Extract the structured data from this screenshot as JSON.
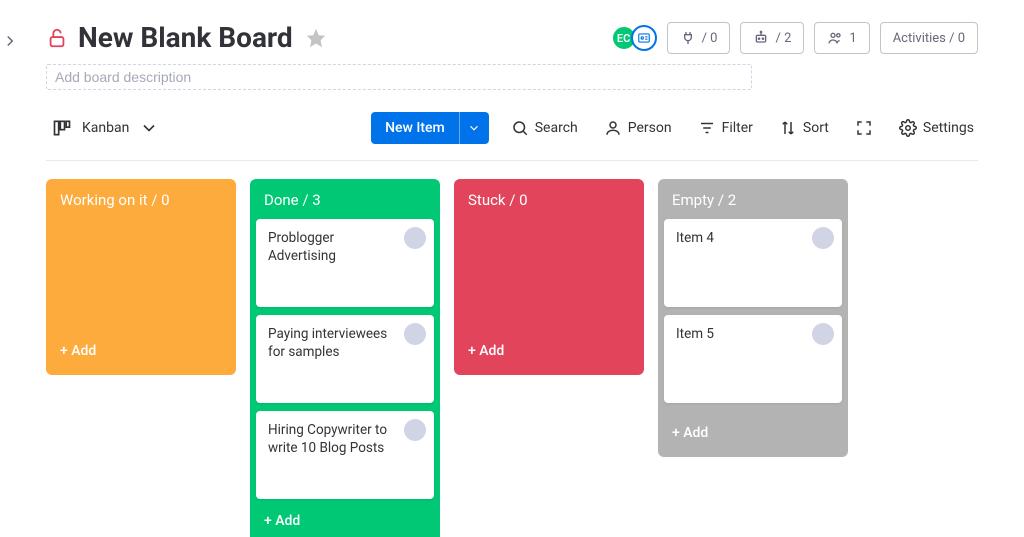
{
  "board": {
    "title": "New Blank Board",
    "description_placeholder": "Add board description"
  },
  "members": {
    "avatar1_label": "EC",
    "plug_count": "/ 0",
    "robot_count": "/ 2",
    "people_count": "1",
    "activities_label": "Activities / 0"
  },
  "toolbar": {
    "view_label": "Kanban",
    "new_item_label": "New Item",
    "search_label": "Search",
    "person_label": "Person",
    "filter_label": "Filter",
    "sort_label": "Sort",
    "settings_label": "Settings"
  },
  "lanes": [
    {
      "title": "Working on it / 0",
      "color": "orange",
      "cards": [],
      "add_label": "+ Add"
    },
    {
      "title": "Done / 3",
      "color": "green",
      "cards": [
        {
          "text": "Problogger Advertising"
        },
        {
          "text": "Paying interviewees for samples"
        },
        {
          "text": "Hiring Copywriter to write 10 Blog Posts"
        }
      ],
      "add_label": "+ Add"
    },
    {
      "title": "Stuck / 0",
      "color": "red",
      "cards": [],
      "add_label": "+ Add"
    },
    {
      "title": "Empty / 2",
      "color": "gray",
      "cards": [
        {
          "text": "Item 4"
        },
        {
          "text": "Item 5"
        }
      ],
      "add_label": "+ Add"
    }
  ]
}
